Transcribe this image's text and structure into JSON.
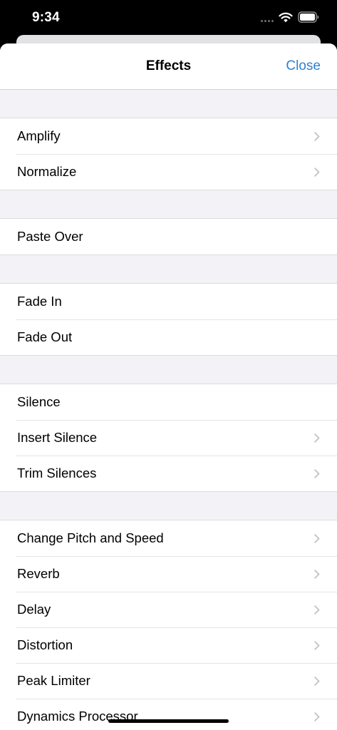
{
  "status_bar": {
    "time": "9:34"
  },
  "nav": {
    "title": "Effects",
    "close_label": "Close"
  },
  "icons": {
    "chevron": "chevron-right-icon",
    "wifi": "wifi-icon",
    "battery": "battery-icon"
  },
  "colors": {
    "accent": "#2f80d1",
    "background": "#f2f2f7",
    "chevron": "#c4c4c7"
  },
  "groups": [
    {
      "items": [
        {
          "label": "Amplify",
          "chevron": true
        },
        {
          "label": "Normalize",
          "chevron": true
        }
      ]
    },
    {
      "items": [
        {
          "label": "Paste Over",
          "chevron": false
        }
      ]
    },
    {
      "items": [
        {
          "label": "Fade In",
          "chevron": false
        },
        {
          "label": "Fade Out",
          "chevron": false
        }
      ]
    },
    {
      "items": [
        {
          "label": "Silence",
          "chevron": false
        },
        {
          "label": "Insert Silence",
          "chevron": true
        },
        {
          "label": "Trim Silences",
          "chevron": true
        }
      ]
    },
    {
      "items": [
        {
          "label": "Change Pitch and Speed",
          "chevron": true
        },
        {
          "label": "Reverb",
          "chevron": true
        },
        {
          "label": "Delay",
          "chevron": true
        },
        {
          "label": "Distortion",
          "chevron": true
        },
        {
          "label": "Peak Limiter",
          "chevron": true
        },
        {
          "label": "Dynamics Processor",
          "chevron": true
        }
      ]
    }
  ]
}
